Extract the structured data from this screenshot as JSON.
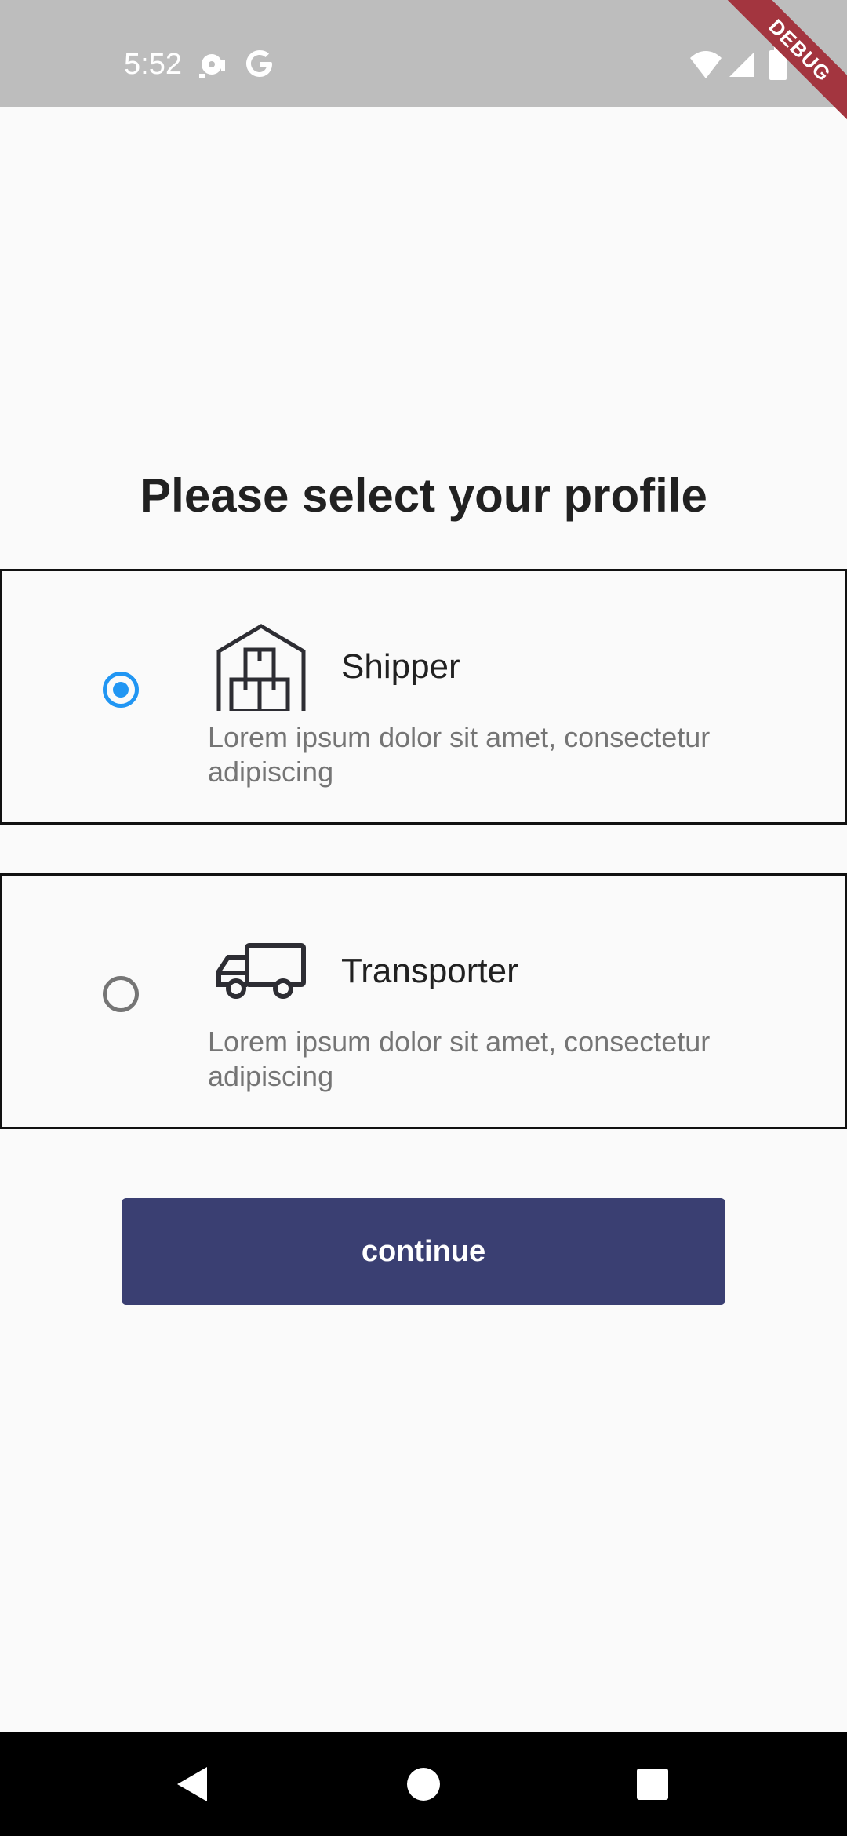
{
  "status_bar": {
    "time": "5:52",
    "debug_label": "DEBUG"
  },
  "page": {
    "title": "Please select your profile"
  },
  "options": [
    {
      "label": "Shipper",
      "description": "Lorem ipsum dolor sit amet, consectetur adipiscing",
      "icon": "warehouse-icon",
      "selected": true
    },
    {
      "label": "Transporter",
      "description": "Lorem ipsum dolor sit amet, consectetur adipiscing",
      "icon": "truck-icon",
      "selected": false
    }
  ],
  "actions": {
    "continue_label": "continue"
  },
  "colors": {
    "accent": "#2196f3",
    "button": "#3a3f72",
    "status_bar": "#bdbdbd",
    "debug_ribbon": "#a3353f"
  },
  "nav_bar": {
    "icons": [
      "back-icon",
      "home-icon",
      "recents-icon"
    ]
  }
}
